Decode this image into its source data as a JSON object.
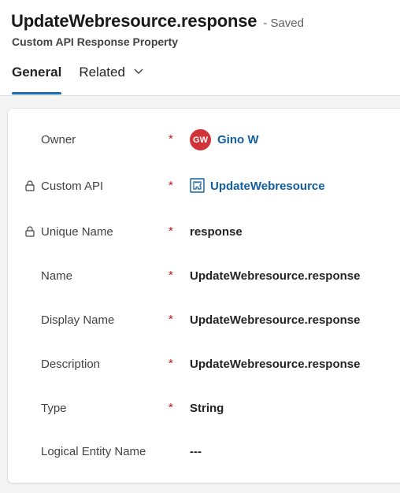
{
  "header": {
    "title": "UpdateWebresource.response",
    "status": "- Saved",
    "subtitle": "Custom API Response Property",
    "tabs": [
      {
        "label": "General",
        "active": true
      },
      {
        "label": "Related",
        "active": false
      }
    ]
  },
  "colors": {
    "accent": "#0f6cbd",
    "link": "#115ea3",
    "required": "#c50f1f",
    "avatar_bg": "#d13438"
  },
  "form": {
    "required_marker": "*",
    "owner": {
      "label": "Owner",
      "initials": "GW",
      "value": "Gino W",
      "icon": "avatar"
    },
    "custom_api": {
      "label": "Custom API",
      "value": "UpdateWebresource",
      "locked": true,
      "icon": "custom-api-entity-icon"
    },
    "unique_name": {
      "label": "Unique Name",
      "value": "response",
      "locked": true
    },
    "name": {
      "label": "Name",
      "value": "UpdateWebresource.response"
    },
    "display_name": {
      "label": "Display Name",
      "value": "UpdateWebresource.response"
    },
    "description": {
      "label": "Description",
      "value": "UpdateWebresource.response"
    },
    "type": {
      "label": "Type",
      "value": "String"
    },
    "logical_entity_name": {
      "label": "Logical Entity Name",
      "value": "---"
    }
  }
}
